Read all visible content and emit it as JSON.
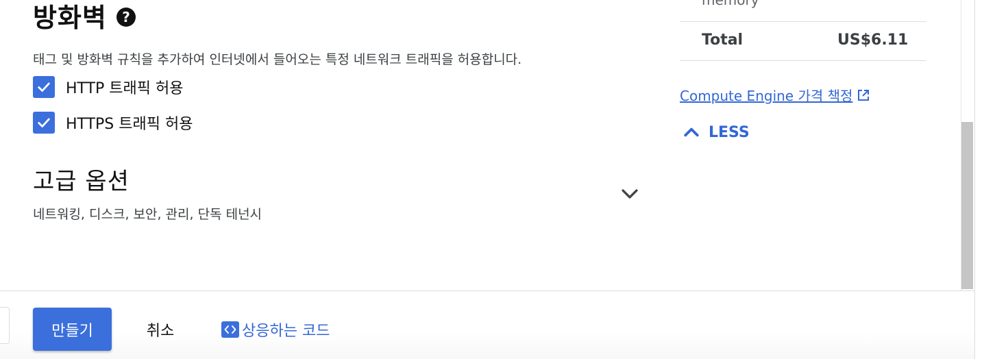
{
  "firewall": {
    "title": "방화벽",
    "help_icon": "help-circle-icon",
    "description": "태그 및 방화벽 규칙을 추가하여 인터넷에서 들어오는 특정 네트워크 트래픽을 허용합니다.",
    "options": [
      {
        "label": "HTTP 트래픽 허용",
        "checked": true
      },
      {
        "label": "HTTPS 트래픽 허용",
        "checked": true
      }
    ]
  },
  "advanced": {
    "title": "고급 옵션",
    "subtitle": "네트워킹, 디스크, 보안, 관리, 단독 테넌시",
    "expand_icon": "chevron-down-icon"
  },
  "cost_summary": {
    "partial_row_label": "memory",
    "total_label": "Total",
    "total_value": "US$6.11",
    "pricing_link": "Compute Engine 가격 책정",
    "pricing_link_icon": "open-in-new-icon",
    "less_label": "LESS",
    "less_icon": "chevron-up-icon"
  },
  "actions": {
    "create_label": "만들기",
    "cancel_label": "취소",
    "code_label": "상응하는 코드",
    "code_icon": "code-icon"
  },
  "colors": {
    "accent": "#3b6fdc",
    "link": "#3367d6"
  }
}
